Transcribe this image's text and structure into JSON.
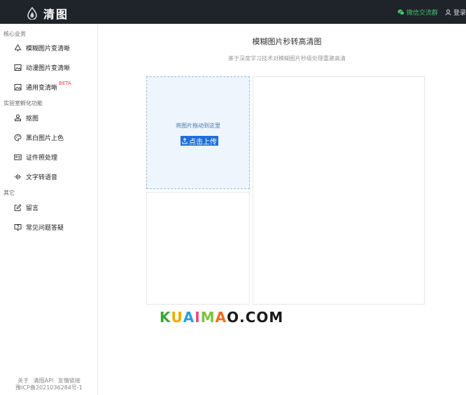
{
  "app": {
    "name": "清图"
  },
  "header": {
    "wechat_label": "微信交流群",
    "login_label": "登录"
  },
  "sidebar": {
    "groups": [
      {
        "title": "核心业务",
        "items": [
          {
            "label": "模糊图片变清晰",
            "icon": "tree-icon"
          },
          {
            "label": "动漫图片变清晰",
            "icon": "image-icon"
          },
          {
            "label": "通用变清晰",
            "icon": "image-icon",
            "badge": "BETA"
          }
        ]
      },
      {
        "title": "实验室孵化功能",
        "items": [
          {
            "label": "抠图",
            "icon": "stamp-icon"
          },
          {
            "label": "黑白图片上色",
            "icon": "palette-icon"
          },
          {
            "label": "证件照处理",
            "icon": "id-card-icon"
          },
          {
            "label": "文字转语音",
            "icon": "audio-wave-icon"
          }
        ]
      },
      {
        "title": "其它",
        "items": [
          {
            "label": "留言",
            "icon": "edit-icon"
          },
          {
            "label": "常见问题答疑",
            "icon": "help-icon"
          }
        ]
      }
    ],
    "footer": {
      "links": [
        "关于",
        "清图API",
        "友情链接"
      ],
      "icp": "豫ICP备2021036284号-1"
    }
  },
  "main": {
    "title": "模糊图片秒转高清图",
    "subtitle": "基于深度学习技术对模糊图片秒级处理重建高清",
    "dropzone": {
      "hint": "将图片拖动到这里",
      "upload_label": "点击上传"
    }
  },
  "watermark": {
    "text": "KUAIMAO.COM"
  },
  "colors": {
    "topbar": "#1f232a",
    "accent": "#1f6fd8",
    "wechat": "#3fc46b",
    "beta": "#e0424a"
  }
}
